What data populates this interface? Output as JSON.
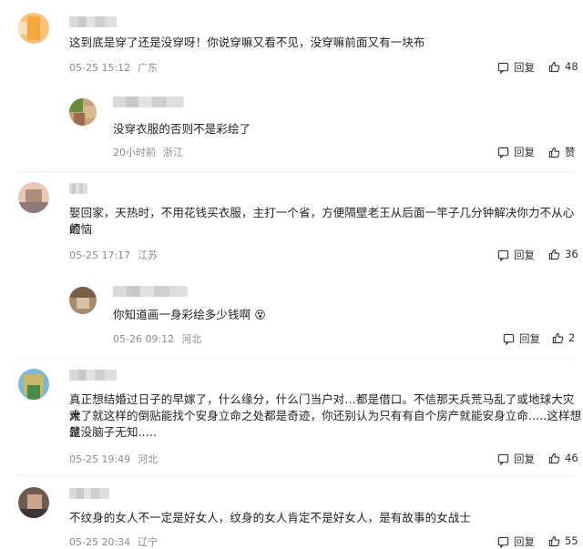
{
  "comments": [
    {
      "text": "这到底是穿了还是没穿呀！你说穿嘛又看不见，没穿嘛前面又有一块布",
      "date": "05-25 15:12",
      "location": "广东",
      "reply_label": "回复",
      "like_count": "48"
    },
    {
      "text": "没穿衣服的否则不是彩绘了",
      "date": "20小时前",
      "location": "浙江",
      "reply_label": "回复",
      "like_count": "赞"
    },
    {
      "text_line1": "娶回家，天热时，不用花钱买衣服，主打一个省，方便隔壁老王从后面一竿子几分钟解决你力不从心的",
      "text_line2": "烦恼",
      "date": "05-25 17:17",
      "location": "江苏",
      "reply_label": "回复",
      "like_count": "36"
    },
    {
      "text": "你知道画一身彩绘多少钱啊",
      "emoji": "😵",
      "date": "05-26 09:12",
      "location": "河北",
      "reply_label": "回复",
      "like_count": "2"
    },
    {
      "text_line1": "真正想结婚过日子的早嫁了，什么缘分，什么门当户对…都是借口。不信那天兵荒马乱了或地球大灾大",
      "text_line2": "难了就这样的倒贴能找个安身立命之处都是奇迹，你还别认为只有有自个房产就能安身立命.....这样想就",
      "text_line3": "是没脑子无知.....",
      "date": "05-25 19:49",
      "location": "河北",
      "reply_label": "回复",
      "like_count": "46"
    },
    {
      "text": "不纹身的女人不一定是好女人，纹身的女人肯定不是好女人，是有故事的女战士",
      "date": "05-25 20:34",
      "location": "辽宁",
      "reply_label": "回复",
      "like_count": "55"
    }
  ]
}
